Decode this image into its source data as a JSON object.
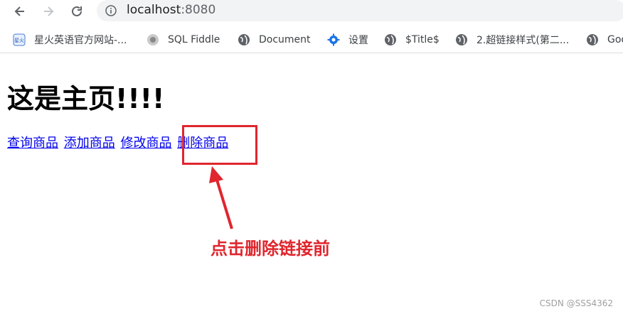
{
  "browser": {
    "url_host": "localhost",
    "url_port": ":8080",
    "icons": {
      "back": "arrow-left",
      "forward": "arrow-right",
      "reload": "reload",
      "info": "info-circle"
    }
  },
  "bookmarks": [
    {
      "label": "星火英语官方网站-...",
      "icon": "xinghuo-logo"
    },
    {
      "label": "SQL Fiddle",
      "icon": "fiddle-logo"
    },
    {
      "label": "Document",
      "icon": "globe"
    },
    {
      "label": "设置",
      "icon": "gear"
    },
    {
      "label": "$Title$",
      "icon": "globe"
    },
    {
      "label": "2.超链接样式(第二...",
      "icon": "globe"
    },
    {
      "label": "Goo",
      "icon": "globe"
    }
  ],
  "page": {
    "heading": "这是主页!!!!",
    "links": [
      "查询商品",
      "添加商品",
      "修改商品",
      "删除商品"
    ]
  },
  "annotation": {
    "text": "点击删除链接前",
    "color": "#e0262e"
  },
  "watermark": "CSDN @SSS4362"
}
